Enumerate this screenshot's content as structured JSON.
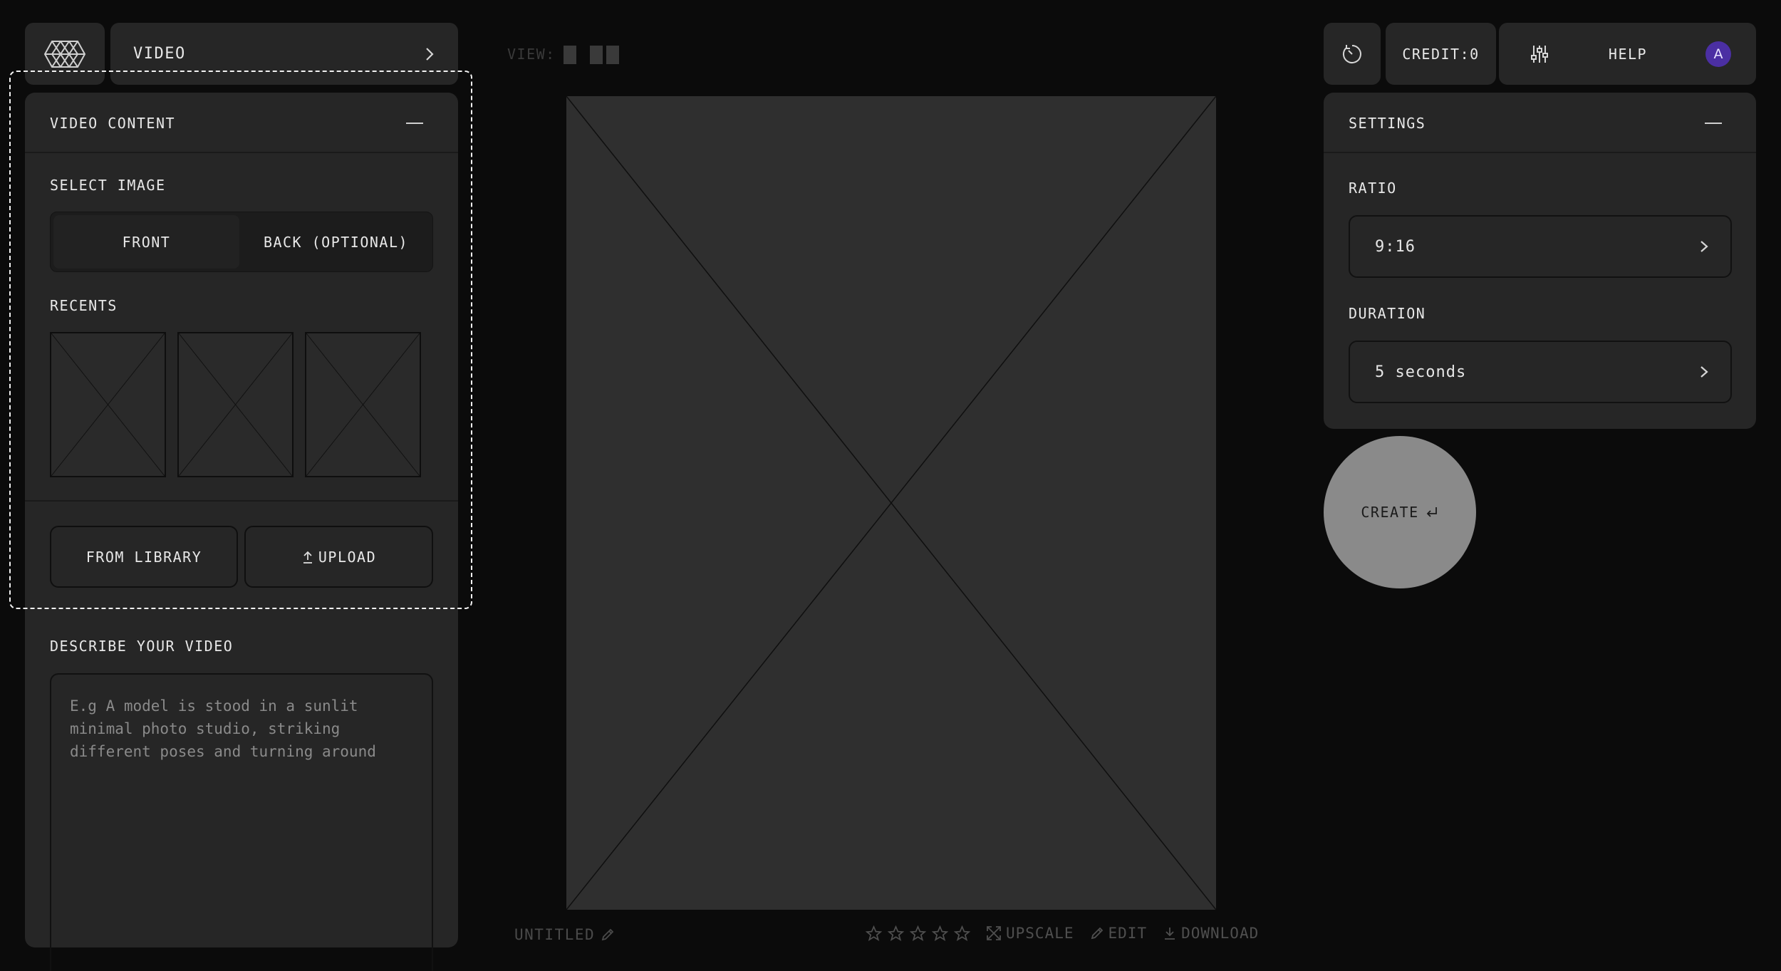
{
  "header": {
    "mode_label": "VIDEO",
    "credit_label": "CREDIT:0",
    "help_label": "HELP",
    "avatar_initial": "A"
  },
  "video_content": {
    "title": "VIDEO CONTENT",
    "select_image_label": "SELECT IMAGE",
    "tabs": [
      {
        "label": "FRONT",
        "selected": true
      },
      {
        "label": "BACK (OPTIONAL)",
        "selected": false
      }
    ],
    "recents_label": "RECENTS",
    "recents_count": 3,
    "from_library_label": "FROM LIBRARY",
    "upload_label": "UPLOAD"
  },
  "describe": {
    "label": "DESCRIBE YOUR VIDEO",
    "placeholder": "E.g A model is stood in a sunlit\nminimal photo studio, striking\ndifferent poses and turning around"
  },
  "canvas": {
    "view_label": "VIEW:",
    "title": "UNTITLED",
    "rating_stars": 5,
    "rating_value": 0,
    "actions": [
      "UPSCALE",
      "EDIT",
      "DOWNLOAD"
    ]
  },
  "settings": {
    "title": "SETTINGS",
    "ratio_label": "RATIO",
    "ratio_value": "9:16",
    "duration_label": "DURATION",
    "duration_value": "5 seconds"
  },
  "create": {
    "label": "CREATE"
  },
  "colors": {
    "background": "#0b0b0b",
    "panel": "#262626",
    "canvas": "#2f2f2f",
    "avatar": "#4b2fa3",
    "create_button": "#8a8a8a",
    "muted_text": "#4f4f4f"
  }
}
